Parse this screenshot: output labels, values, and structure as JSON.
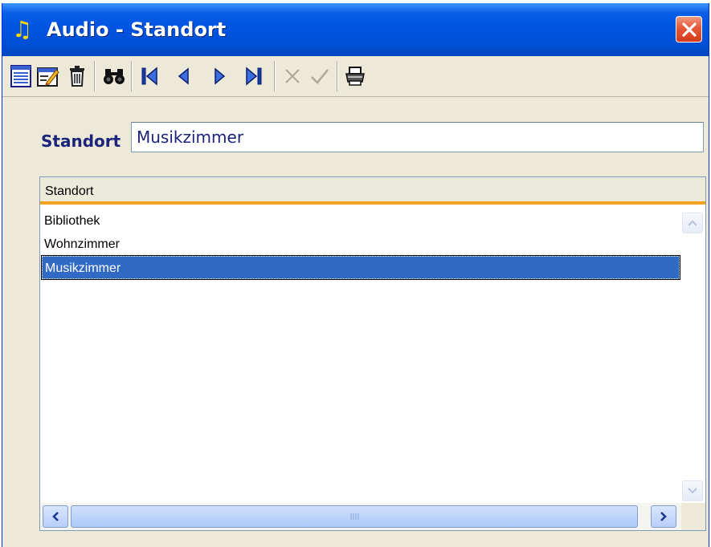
{
  "window": {
    "title": "Audio - Standort",
    "icons": {
      "app": "music-note-icon",
      "close": "close-icon"
    },
    "accent_color": "#0054e3"
  },
  "toolbar": {
    "buttons": [
      {
        "name": "list-view",
        "icon": "list-icon"
      },
      {
        "name": "edit",
        "icon": "edit-form-icon"
      },
      {
        "name": "delete",
        "icon": "trash-icon"
      },
      {
        "name": "search",
        "icon": "binoculars-icon"
      },
      {
        "name": "first",
        "icon": "first-record-icon"
      },
      {
        "name": "previous",
        "icon": "previous-record-icon"
      },
      {
        "name": "next",
        "icon": "next-record-icon"
      },
      {
        "name": "last",
        "icon": "last-record-icon"
      },
      {
        "name": "cancel",
        "icon": "cancel-icon",
        "enabled": false
      },
      {
        "name": "confirm",
        "icon": "checkmark-icon",
        "enabled": false
      },
      {
        "name": "print",
        "icon": "printer-icon"
      }
    ]
  },
  "form": {
    "label": "Standort",
    "value": "Musikzimmer"
  },
  "grid": {
    "column_header": "Standort",
    "header_accent_color": "#f4a422",
    "selection_color": "#316ac5",
    "rows": [
      "Bibliothek",
      "Wohnzimmer",
      "Musikzimmer"
    ],
    "selected_row": "Musikzimmer"
  }
}
